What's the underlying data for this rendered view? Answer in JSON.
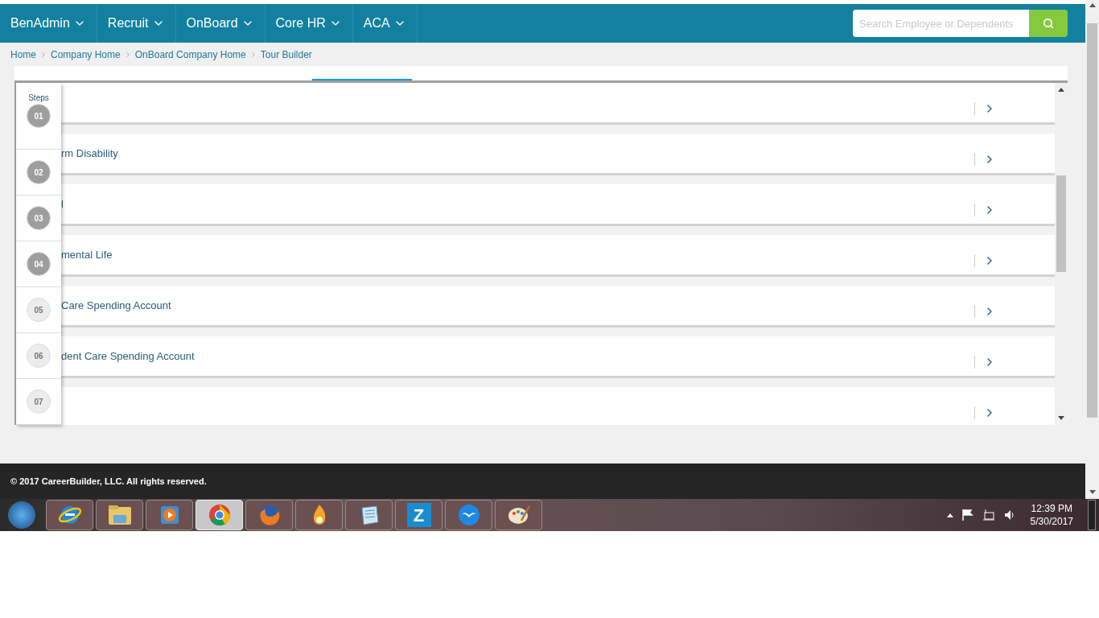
{
  "nav": {
    "items": [
      {
        "label": "BenAdmin"
      },
      {
        "label": "Recruit"
      },
      {
        "label": "OnBoard"
      },
      {
        "label": "Core HR"
      },
      {
        "label": "ACA"
      }
    ],
    "search": {
      "placeholder": "Search Employee or Dependents"
    }
  },
  "breadcrumb": [
    "Home",
    "Company Home",
    "OnBoard Company Home",
    "Tour Builder"
  ],
  "tabs": [
    {
      "selected": true
    }
  ],
  "rows": [
    {
      "title": ""
    },
    {
      "title": "rm Disability"
    },
    {
      "title": "l"
    },
    {
      "title": "mental Life"
    },
    {
      "title": "Care Spending Account"
    },
    {
      "title": "dent Care Spending Account"
    },
    {
      "title": ""
    }
  ],
  "steps": {
    "title": "Steps",
    "items": [
      {
        "label": "01",
        "dimmed": true
      },
      {
        "label": "02",
        "dimmed": true
      },
      {
        "label": "03",
        "dimmed": true
      },
      {
        "label": "04",
        "dimmed": true
      },
      {
        "label": "05",
        "dimmed": false
      },
      {
        "label": "06",
        "dimmed": false
      },
      {
        "label": "07",
        "dimmed": false
      }
    ]
  },
  "footer": {
    "text": "© 2017 CareerBuilder, LLC. All rights reserved."
  },
  "taskbar": {
    "apps": [
      {
        "kind": "ie",
        "selected": false
      },
      {
        "kind": "folder",
        "selected": false
      },
      {
        "kind": "media",
        "selected": false
      },
      {
        "kind": "chrome",
        "selected": true
      },
      {
        "kind": "firefox",
        "selected": false
      },
      {
        "kind": "flame",
        "selected": false
      },
      {
        "kind": "notepad",
        "selected": false
      },
      {
        "kind": "z",
        "selected": false
      },
      {
        "kind": "bird",
        "selected": false
      },
      {
        "kind": "paint",
        "selected": false
      }
    ],
    "z_letter": "Z",
    "time": "12:39 PM",
    "date": "5/30/2017"
  }
}
